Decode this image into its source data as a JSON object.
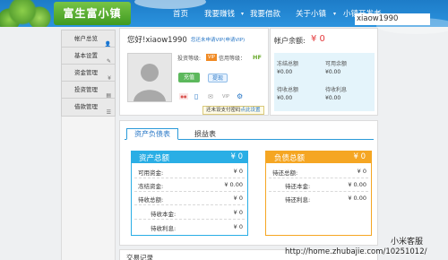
{
  "header": {
    "logo": "富生富小镇",
    "nav": [
      "首页",
      "我要赚钱",
      "我要借款",
      "关于小镇",
      "小镇开发者"
    ],
    "username": "xiaow1990"
  },
  "sidebar": {
    "items": [
      {
        "label": "帐户总览",
        "icon": "user-icon"
      },
      {
        "label": "基本设置",
        "icon": "wrench-icon"
      },
      {
        "label": "资金管理",
        "icon": "money-icon"
      },
      {
        "label": "投资管理",
        "icon": "chart-icon"
      },
      {
        "label": "借款管理",
        "icon": "list-icon"
      }
    ]
  },
  "profile": {
    "greeting": "您好!xiaow1990",
    "verify_link": "您还未申请VIP(申请VIP)",
    "invest_level_label": "投资等级:",
    "invest_level_badge": "VIP",
    "credit_level_label": "信用等级：",
    "credit_level_value": "HF",
    "recharge": "充值",
    "withdraw": "提现",
    "tooltip": "还未设支付密码",
    "tooltip_link": "点此设置",
    "badges": [
      "●●",
      "▯",
      "✉",
      "VIP",
      "⚙"
    ]
  },
  "balance": {
    "title": "帐户余额:",
    "amount": "¥ 0",
    "cells": [
      {
        "label": "冻结总额",
        "value": "¥0.00"
      },
      {
        "label": "可用余额",
        "value": "¥0.00"
      },
      {
        "label": "待收总额",
        "value": "¥0.00"
      },
      {
        "label": "待收利息",
        "value": "¥0.00"
      }
    ]
  },
  "tabs": [
    "资产负债表",
    "损益表"
  ],
  "assets": {
    "title": "资产总额",
    "total": "¥ 0",
    "color": "#2aaee5",
    "rows": [
      {
        "label": "可用资金:",
        "value": "¥ 0"
      },
      {
        "label": "冻结资金:",
        "value": "¥ 0.00"
      },
      {
        "label": "待收总额:",
        "value": "¥ 0"
      },
      {
        "label": "待收本金:",
        "value": "¥ 0",
        "indent": true
      },
      {
        "label": "待收利息:",
        "value": "¥ 0",
        "indent": true
      }
    ]
  },
  "liabilities": {
    "title": "负债总额",
    "total": "¥ 0",
    "color": "#f5a623",
    "rows": [
      {
        "label": "待还总额:",
        "value": "¥ 0"
      },
      {
        "label": "待还本金:",
        "value": "¥ 0.00",
        "indent": true
      },
      {
        "label": "待还利息:",
        "value": "¥ 0.00",
        "indent": true
      }
    ]
  },
  "footer": {
    "partial_title": "交易记录"
  },
  "watermark": {
    "line1": "小米客服",
    "line2": "http://home.zhubajie.com/10251012/"
  }
}
